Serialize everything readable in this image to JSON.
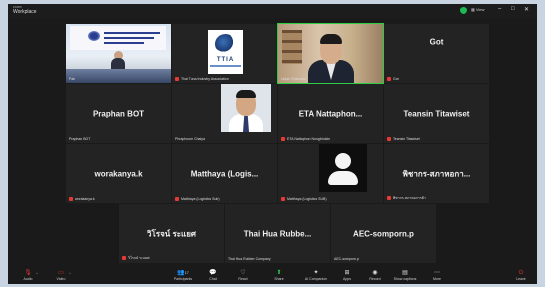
{
  "app": {
    "name_small": "zoom",
    "name_big": "Workplace",
    "view_label": "View",
    "colors": {
      "accent_green": "#2ecc40",
      "muted_red": "#e53935",
      "background": "#1a1a1a"
    }
  },
  "tiles": [
    {
      "id": "pak",
      "caption": "Pak",
      "video": "meeting-room"
    },
    {
      "id": "ttia",
      "caption": "Thai Tuna Industry Association",
      "video": "ttia-logo"
    },
    {
      "id": "udom",
      "caption": "Udom Srisuwan",
      "video": "office-man",
      "active": true
    },
    {
      "id": "got",
      "name": "Got",
      "caption": "Got"
    },
    {
      "id": "praphan",
      "name": "Praphan  BOT",
      "caption": "Praphan BOT"
    },
    {
      "id": "phraphoom",
      "caption": "Phraphoom Chaiya",
      "video": "portrait"
    },
    {
      "id": "eta",
      "name": "ETA  Nattaphon...",
      "caption": "ETA Nattaphon Nongbhokin"
    },
    {
      "id": "teansin",
      "name": "Teansin Titawiset",
      "caption": "Teansin Titawiset"
    },
    {
      "id": "worakanya",
      "name": "worakanya.k",
      "caption": "worakanya.k"
    },
    {
      "id": "matthaya1",
      "name": "Matthaya  (Logis...",
      "caption": "Matthaya (Logistics Sub)"
    },
    {
      "id": "matthaya2",
      "caption": "Matthaya (Logistics SUB)",
      "video": "avatar"
    },
    {
      "id": "phitchakon",
      "name": "พิชากร-สภาหอกา...",
      "caption": "พิชากร-สภาหอการค้า"
    },
    {
      "id": "wirot",
      "name": "วิโรจน์   ระแยศ",
      "caption": "วิโรจน์ ระแยศ"
    },
    {
      "id": "thaihua",
      "name": "Thai Hua Rubbe...",
      "caption": "Thai Hua Rubber Company"
    },
    {
      "id": "aec",
      "name": "AEC-somporn.p",
      "caption": "AEC-somporn.p"
    }
  ],
  "toolbar": {
    "audio": {
      "label": "Audio",
      "icon": "mic-muted-icon"
    },
    "video": {
      "label": "Video",
      "icon": "video-off-icon"
    },
    "participants": {
      "label": "Participants",
      "icon": "participants-icon",
      "count": "17"
    },
    "chat": {
      "label": "Chat",
      "icon": "chat-icon"
    },
    "react": {
      "label": "React",
      "icon": "react-icon"
    },
    "share": {
      "label": "Share",
      "icon": "share-icon"
    },
    "ai": {
      "label": "AI Companion",
      "icon": "ai-companion-icon"
    },
    "apps": {
      "label": "Apps",
      "icon": "apps-icon"
    },
    "record": {
      "label": "Record",
      "icon": "record-icon"
    },
    "captions": {
      "label": "Show captions",
      "icon": "captions-icon"
    },
    "more": {
      "label": "More",
      "icon": "more-icon"
    },
    "leave": {
      "label": "Leave",
      "icon": "leave-icon"
    }
  }
}
